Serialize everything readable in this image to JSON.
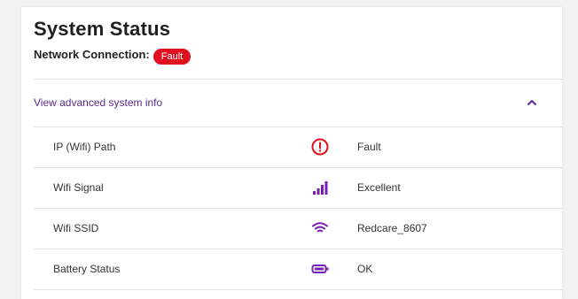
{
  "header": {
    "title": "System Status",
    "network_label": "Network Connection:",
    "network_status": "Fault"
  },
  "advanced": {
    "link_label": "View advanced system info",
    "expanded": true,
    "toggle_icon": "chevron-up-icon"
  },
  "rows": [
    {
      "label": "IP (Wifi) Path",
      "icon": "alert-circle-icon",
      "value": "Fault"
    },
    {
      "label": "Wifi Signal",
      "icon": "signal-bars-icon",
      "value": "Excellent"
    },
    {
      "label": "Wifi SSID",
      "icon": "wifi-icon",
      "value": "Redcare_8607"
    },
    {
      "label": "Battery Status",
      "icon": "battery-icon",
      "value": "OK"
    }
  ],
  "colors": {
    "fault_red": "#e0101e",
    "accent_purple": "#5a2a8c",
    "icon_purple": "#7a1fb8"
  }
}
